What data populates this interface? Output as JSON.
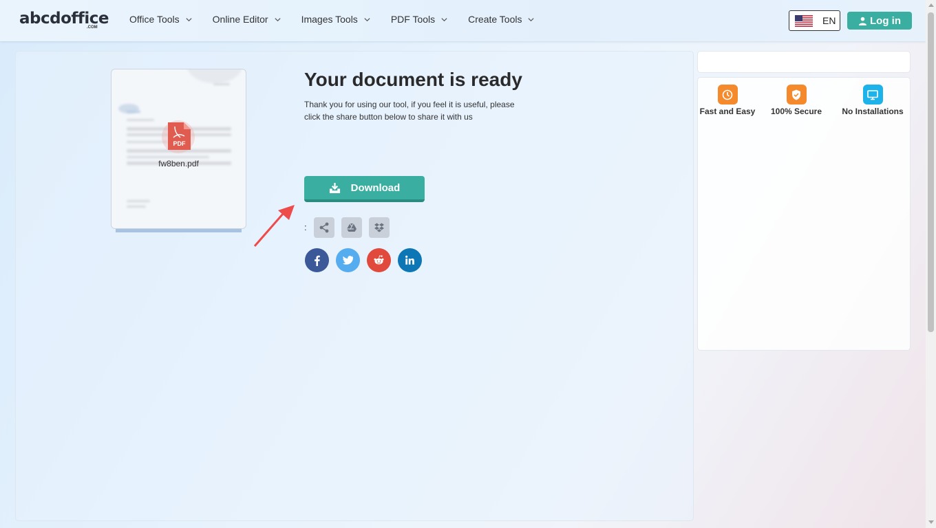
{
  "header": {
    "logo_text": "abcdoffice",
    "logo_sub": ".COM",
    "nav": [
      {
        "label": "Office Tools"
      },
      {
        "label": "Online Editor"
      },
      {
        "label": "Images Tools"
      },
      {
        "label": "PDF Tools"
      },
      {
        "label": "Create Tools"
      }
    ],
    "language": "EN",
    "login_label": "Log in"
  },
  "main": {
    "file_badge": "PDF",
    "filename": "fw8ben.pdf",
    "title": "Your document is ready",
    "description": "Thank you for using our tool, if you feel it is useful, please click the share button below to share it with us",
    "download_label": "Download",
    "share_colon": ":",
    "share_icons": [
      "share-icon",
      "google-drive-icon",
      "dropbox-icon"
    ],
    "social_icons": [
      "facebook-icon",
      "twitter-icon",
      "reddit-icon",
      "linkedin-icon"
    ]
  },
  "sidebar": {
    "features": [
      {
        "label": "Fast and Easy",
        "icon": "clock-icon",
        "color": "#f48a2b"
      },
      {
        "label": "100% Secure",
        "icon": "shield-icon",
        "color": "#f48a2b"
      },
      {
        "label": "No Installations",
        "icon": "monitor-icon",
        "color": "#1db3ea"
      }
    ]
  },
  "colors": {
    "accent": "#3aaea0",
    "facebook": "#3b5998",
    "twitter": "#55acee",
    "reddit": "#e0493c",
    "linkedin": "#0d77b5"
  }
}
